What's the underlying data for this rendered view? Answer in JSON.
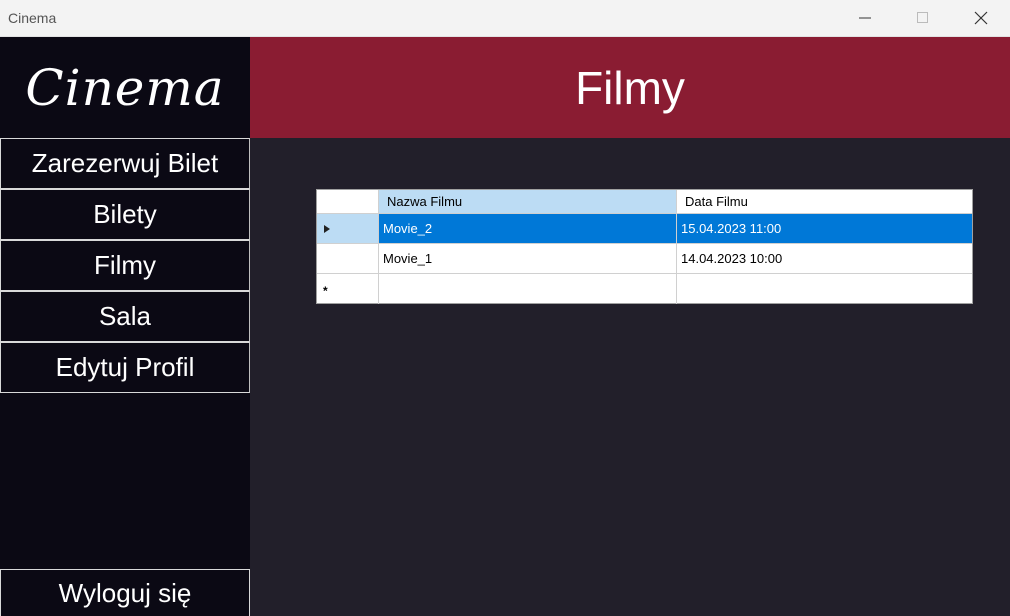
{
  "window": {
    "title": "Cinema"
  },
  "sidebar": {
    "logo": "Cinema",
    "items": [
      {
        "label": "Zarezerwuj Bilet"
      },
      {
        "label": "Bilety"
      },
      {
        "label": "Filmy"
      },
      {
        "label": "Sala"
      },
      {
        "label": "Edytuj Profil"
      }
    ],
    "logout": "Wyloguj się"
  },
  "header": {
    "title": "Filmy"
  },
  "grid": {
    "columns": [
      "Nazwa Filmu",
      "Data Filmu"
    ],
    "rows": [
      {
        "nazwa": "Movie_2",
        "data": "15.04.2023 11:00",
        "selected": true
      },
      {
        "nazwa": "Movie_1",
        "data": "14.04.2023 10:00",
        "selected": false
      }
    ],
    "new_row_marker": "*"
  },
  "colors": {
    "sidebar_bg": "#0b0914",
    "header_bg": "#8a1c32",
    "main_bg": "#221f2a",
    "selection": "#0078d7",
    "header_highlight": "#bcdcf4"
  },
  "icons": [
    "minimize-icon",
    "maximize-icon",
    "close-icon",
    "current-row-arrow-icon",
    "new-row-icon"
  ]
}
